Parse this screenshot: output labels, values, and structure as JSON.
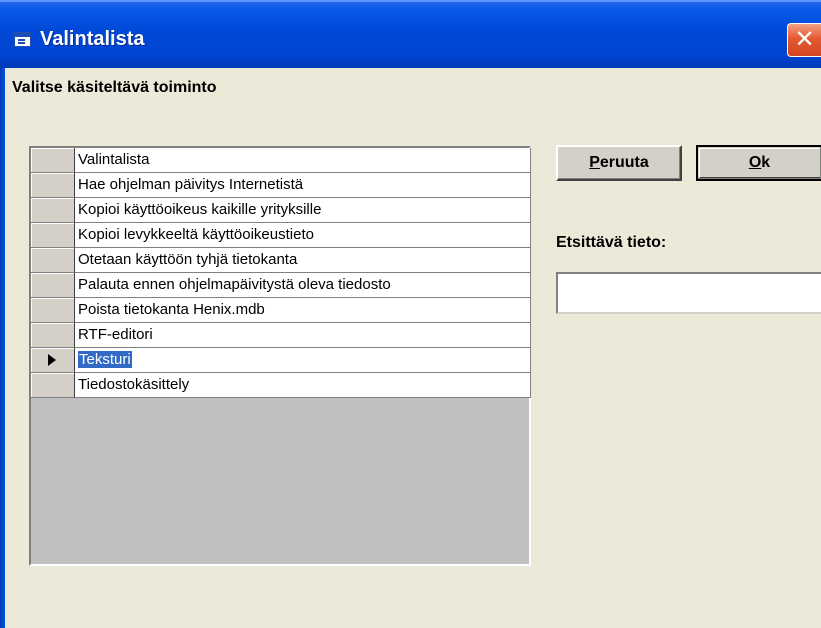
{
  "window": {
    "title": "Valintalista",
    "close_glyph": "✕"
  },
  "prompt": "Valitse käsiteltävä toiminto",
  "grid": {
    "header": "Valintalista",
    "rows": [
      "Hae ohjelman päivitys Internetistä",
      "Kopioi käyttöoikeus kaikille yrityksille",
      "Kopioi levykkeeltä käyttöoikeustieto",
      "Otetaan käyttöön tyhjä tietokanta",
      "Palauta ennen ohjelmapäivitystä oleva tiedosto",
      "Poista tietokanta Henix.mdb",
      "RTF-editori",
      "Teksturi",
      "Tiedostokäsittely"
    ],
    "selected_index": 7
  },
  "buttons": {
    "cancel_label": "Peruuta",
    "ok_label": "Ok"
  },
  "search": {
    "label": "Etsittävä tieto:",
    "value": "",
    "placeholder": ""
  },
  "colors": {
    "titlebar": "#0045D2",
    "dialog_bg": "#ECE9D8",
    "selection": "#316AC5"
  }
}
